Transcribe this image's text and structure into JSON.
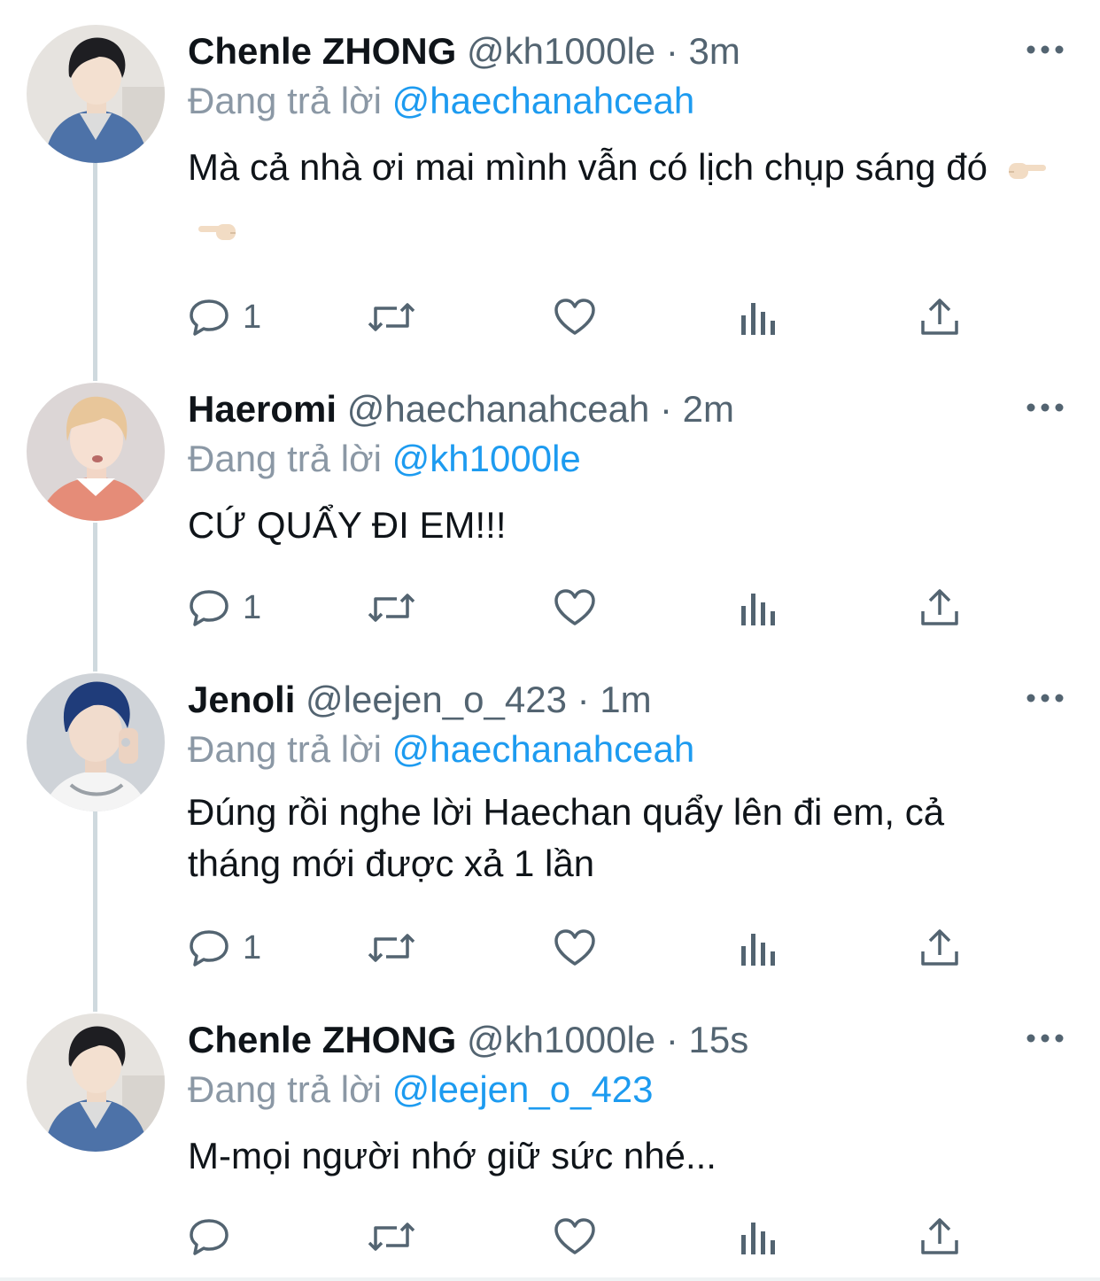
{
  "tweets": [
    {
      "name": "Chenle ZHONG",
      "handle": "@kh1000le",
      "separator": "·",
      "time": "3m",
      "replying_prefix": "Đang trả lời",
      "replying_to": "@haechanahceah",
      "text": "Mà cả nhà ơi mai mình vẫn có lịch chụp sáng đó",
      "emojis": [
        "pointing-right-icon",
        "pointing-left-icon"
      ],
      "reply_count": "1"
    },
    {
      "name": "Haeromi",
      "handle": "@haechanahceah",
      "separator": "·",
      "time": "2m",
      "replying_prefix": "Đang trả lời",
      "replying_to": "@kh1000le",
      "text": "CỨ QUẨY ĐI EM!!!",
      "reply_count": "1"
    },
    {
      "name": "Jenoli",
      "handle": "@leejen_o_423",
      "separator": "·",
      "time": "1m",
      "replying_prefix": "Đang trả lời",
      "replying_to": "@haechanahceah",
      "text": "Đúng rồi nghe lời Haechan quẩy lên đi em, cả tháng mới được xả 1 lần",
      "reply_count": "1"
    },
    {
      "name": "Chenle ZHONG",
      "handle": "@kh1000le",
      "separator": "·",
      "time": "15s",
      "replying_prefix": "Đang trả lời",
      "replying_to": "@leejen_o_423",
      "text": "M-mọi người nhớ giữ sức nhé...",
      "reply_count": ""
    }
  ],
  "action_icons": [
    "reply-icon",
    "retweet-icon",
    "like-icon",
    "analytics-icon",
    "share-icon"
  ],
  "colors": {
    "text": "#0f1419",
    "secondary": "#536471",
    "mention": "#1d9bf0",
    "thread_line": "#cfd9de"
  }
}
